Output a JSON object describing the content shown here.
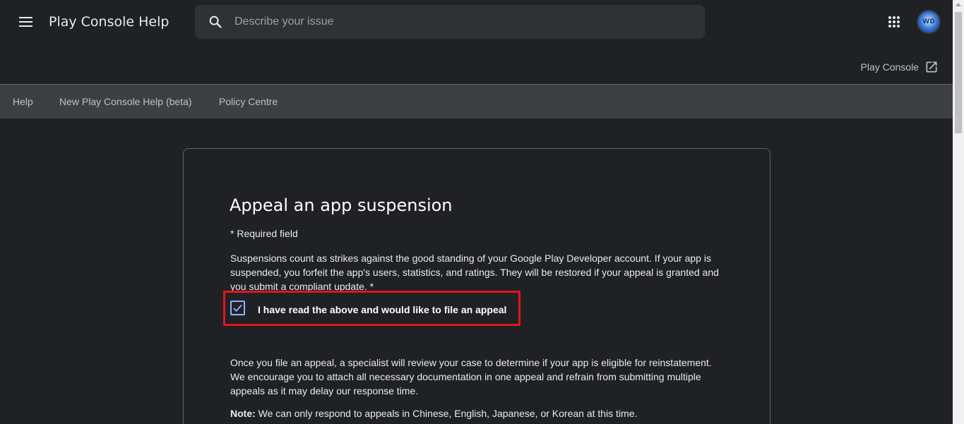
{
  "header": {
    "app_title": "Play Console Help",
    "search_placeholder": "Describe your issue",
    "avatar_text": "WD"
  },
  "subheader": {
    "console_link": "Play Console"
  },
  "nav": {
    "items": [
      "Help",
      "New Play Console Help (beta)",
      "Policy Centre"
    ]
  },
  "card": {
    "title": "Appeal an app suspension",
    "required_note": "* Required field",
    "paragraph1": "Suspensions count as strikes against the good standing of your Google Play Developer account. If your app is suspended, you forfeit the app's users, statistics, and ratings. They will be restored if your appeal is granted and you submit a compliant update. *",
    "checkbox_label": "I have read the above and would like to file an appeal",
    "checkbox_checked": true,
    "paragraph2": "Once you file an appeal, a specialist will review your case to determine if your app is eligible for reinstatement. We encourage you to attach all necessary documentation in one appeal and refrain from submitting multiple appeals as it may delay our response time.",
    "note_label": "Note:",
    "note_text": " We can only respond to appeals in Chinese, English, Japanese, or Korean at this time."
  },
  "colors": {
    "background": "#202124",
    "nav_background": "#3c4043",
    "highlight_border": "#e3141d",
    "checkbox_accent": "#8ab4f8"
  },
  "icons": {
    "menu": "hamburger-menu-icon",
    "search": "search-icon",
    "apps": "apps-grid-icon",
    "external": "open-in-new-icon",
    "check": "checkmark-icon"
  }
}
